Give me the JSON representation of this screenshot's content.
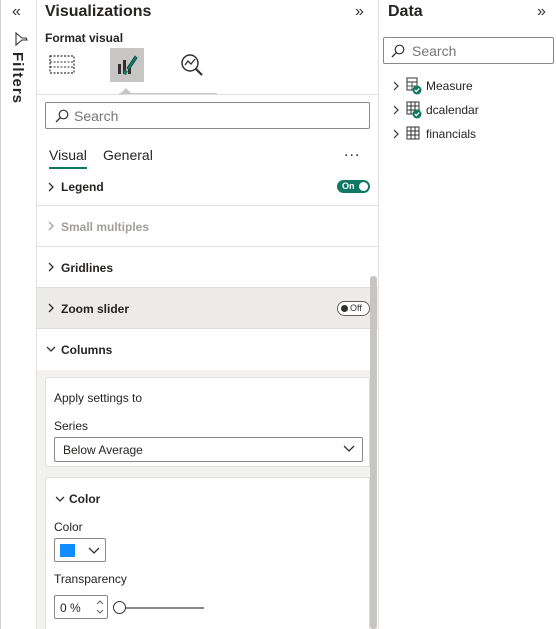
{
  "filters": {
    "label": "Filters"
  },
  "visualizations": {
    "title": "Visualizations",
    "format_label": "Format visual",
    "search_placeholder": "Search",
    "tabs": [
      {
        "label": "Visual"
      },
      {
        "label": "General"
      }
    ],
    "more_label": "...",
    "sections": {
      "legend": {
        "label": "Legend",
        "toggle": "On"
      },
      "small_multiples": {
        "label": "Small multiples"
      },
      "gridlines": {
        "label": "Gridlines"
      },
      "zoom_slider": {
        "label": "Zoom slider",
        "toggle": "Off"
      },
      "columns": {
        "label": "Columns"
      }
    },
    "apply_settings": {
      "title": "Apply settings to",
      "series_label": "Series",
      "series_value": "Below Average"
    },
    "color_card": {
      "title": "Color",
      "color_label": "Color",
      "color_value": "#118dff",
      "transparency_label": "Transparency",
      "transparency_value": "0 %",
      "transparency_level": 0
    }
  },
  "data_pane": {
    "title": "Data",
    "search_placeholder": "Search",
    "items": [
      {
        "label": "Measure",
        "icon": "calculator-table-icon"
      },
      {
        "label": "dcalendar",
        "icon": "table-icon"
      },
      {
        "label": "financials",
        "icon": "table-icon"
      }
    ]
  },
  "colors": {
    "accent": "#117865",
    "series_color": "#118dff"
  }
}
